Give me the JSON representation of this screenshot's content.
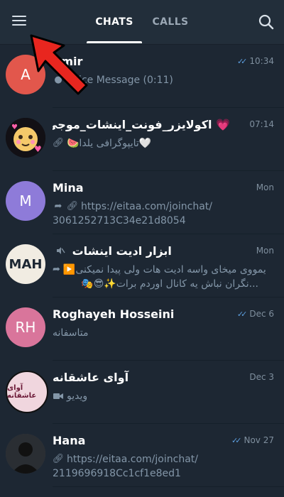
{
  "header": {
    "tabs": [
      {
        "label": "CHATS",
        "active": true
      },
      {
        "label": "CALLS",
        "active": false
      }
    ]
  },
  "chats": [
    {
      "name": "Amir",
      "avatar_text": "A",
      "avatar_color": "#e2574c",
      "time": "10:34",
      "read": true,
      "message": "Voice Message (0:11)"
    },
    {
      "name": "💗 اکولایزر_فونت_اینشات_موجی_💗",
      "avatar_text": "",
      "time": "07:14",
      "muted": true,
      "message": "🤍تایپوگرافی یلدا🍉"
    },
    {
      "name": "Mina",
      "avatar_text": "M",
      "avatar_color": "#8e7bd9",
      "time": "Mon",
      "message_line1": "https://eitaa.com/joinchat/",
      "message_line2": "3061252713C34e21d8054"
    },
    {
      "name": "ابزار ادیت اینشات",
      "avatar_text": "MAH",
      "avatar_color": "#f1ece2",
      "time": "Mon",
      "muted": true,
      "message_line1": "🌿 ایمووی میخای واسه ادیت هات ولی پیدا نمیکنی▶️",
      "message_line2": "...نگران نباش یه کانال اوردم برات✨😎🎭"
    },
    {
      "name": "Roghayeh Hosseini",
      "avatar_text": "RH",
      "avatar_color": "#d9759b",
      "time": "Dec 6",
      "read": true,
      "message": "متاسفانه"
    },
    {
      "name": "آوای عاشقانه",
      "avatar_text": "آوای عاشقانه",
      "avatar_color": "#f0d6de",
      "time": "Dec 3",
      "message": "ویدیو"
    },
    {
      "name": "Hana",
      "avatar_text": "",
      "avatar_color": "#3a3f45",
      "time": "Nov 27",
      "read": true,
      "message_line1": "https://eitaa.com/joinchat/",
      "message_line2": "2119696918Cc1cf1e8ed1"
    }
  ],
  "icons": {
    "menu": "hamburger-menu-icon",
    "search": "search-icon",
    "read": "double-check-icon",
    "muted": "muted-speaker-icon",
    "link": "link-icon",
    "forward": "forward-arrow-icon",
    "video": "video-camera-icon",
    "mic": "microphone-icon"
  }
}
